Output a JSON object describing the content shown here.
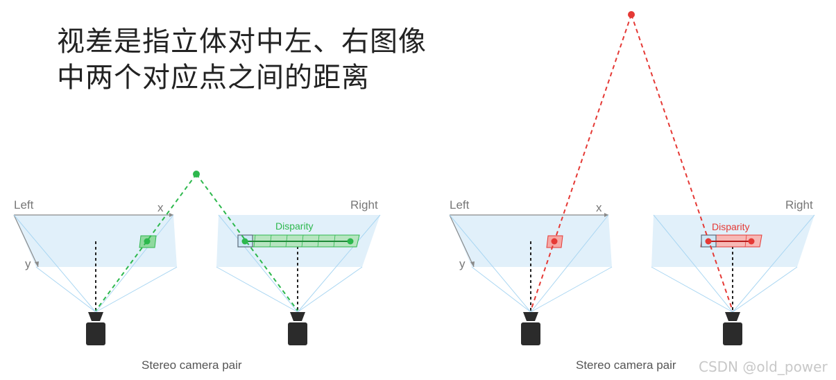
{
  "heading": {
    "line1": "视差是指立体对中左、右图像",
    "line2": "中两个对应点之间的距离"
  },
  "left_diagram": {
    "left_label": "Left",
    "right_label": "Right",
    "x_axis": "x",
    "y_axis": "y",
    "disparity_label": "Disparity",
    "accent_color": "#2db84d",
    "caption": "Stereo camera pair"
  },
  "right_diagram": {
    "left_label": "Left",
    "right_label": "Right",
    "x_axis": "x",
    "y_axis": "y",
    "disparity_label": "Disparity",
    "accent_color": "#e53935",
    "caption": "Stereo camera pair"
  },
  "watermark": "CSDN @old_power"
}
